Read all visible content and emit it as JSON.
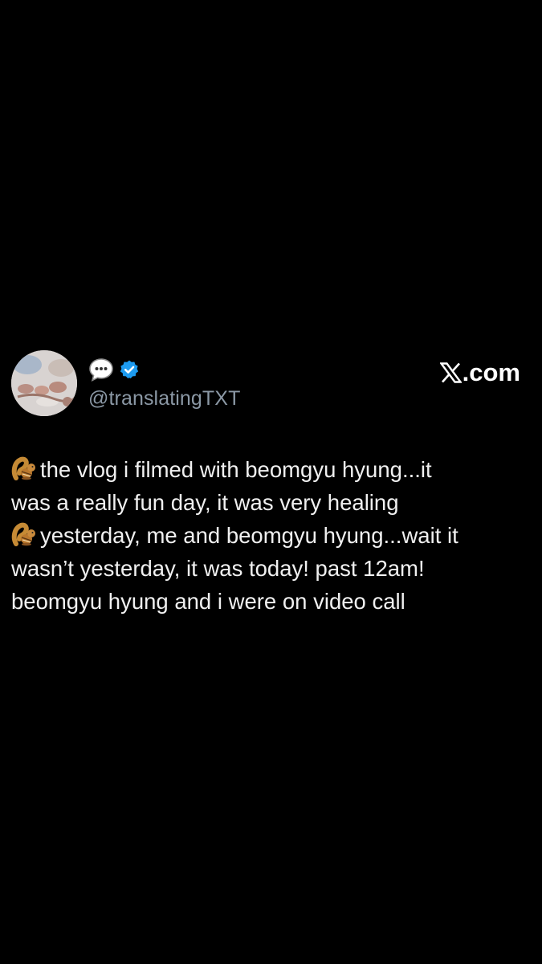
{
  "account": {
    "display_name_icon": "speech-bubble-icon",
    "verified_icon": "verified-badge-icon",
    "verified_color": "#1d9bf0",
    "handle": "@translatingTXT",
    "avatar_icon": "avatar-photo"
  },
  "brand": {
    "logo_icon": "x-logo-icon",
    "suffix": ".com"
  },
  "tweet": {
    "emoji_icon": "chipmunk-emoji-icon",
    "lines": [
      "the vlog i filmed with beomgyu hyung...it",
      "was a really fun day, it was very healing",
      "yesterday, me and beomgyu hyung...wait it",
      "wasn’t yesterday, it was today! past 12am!",
      "beomgyu hyung and i were on video call"
    ]
  },
  "colors": {
    "background": "#000000",
    "text": "#f0f0f0",
    "handle": "#8b98a5"
  }
}
